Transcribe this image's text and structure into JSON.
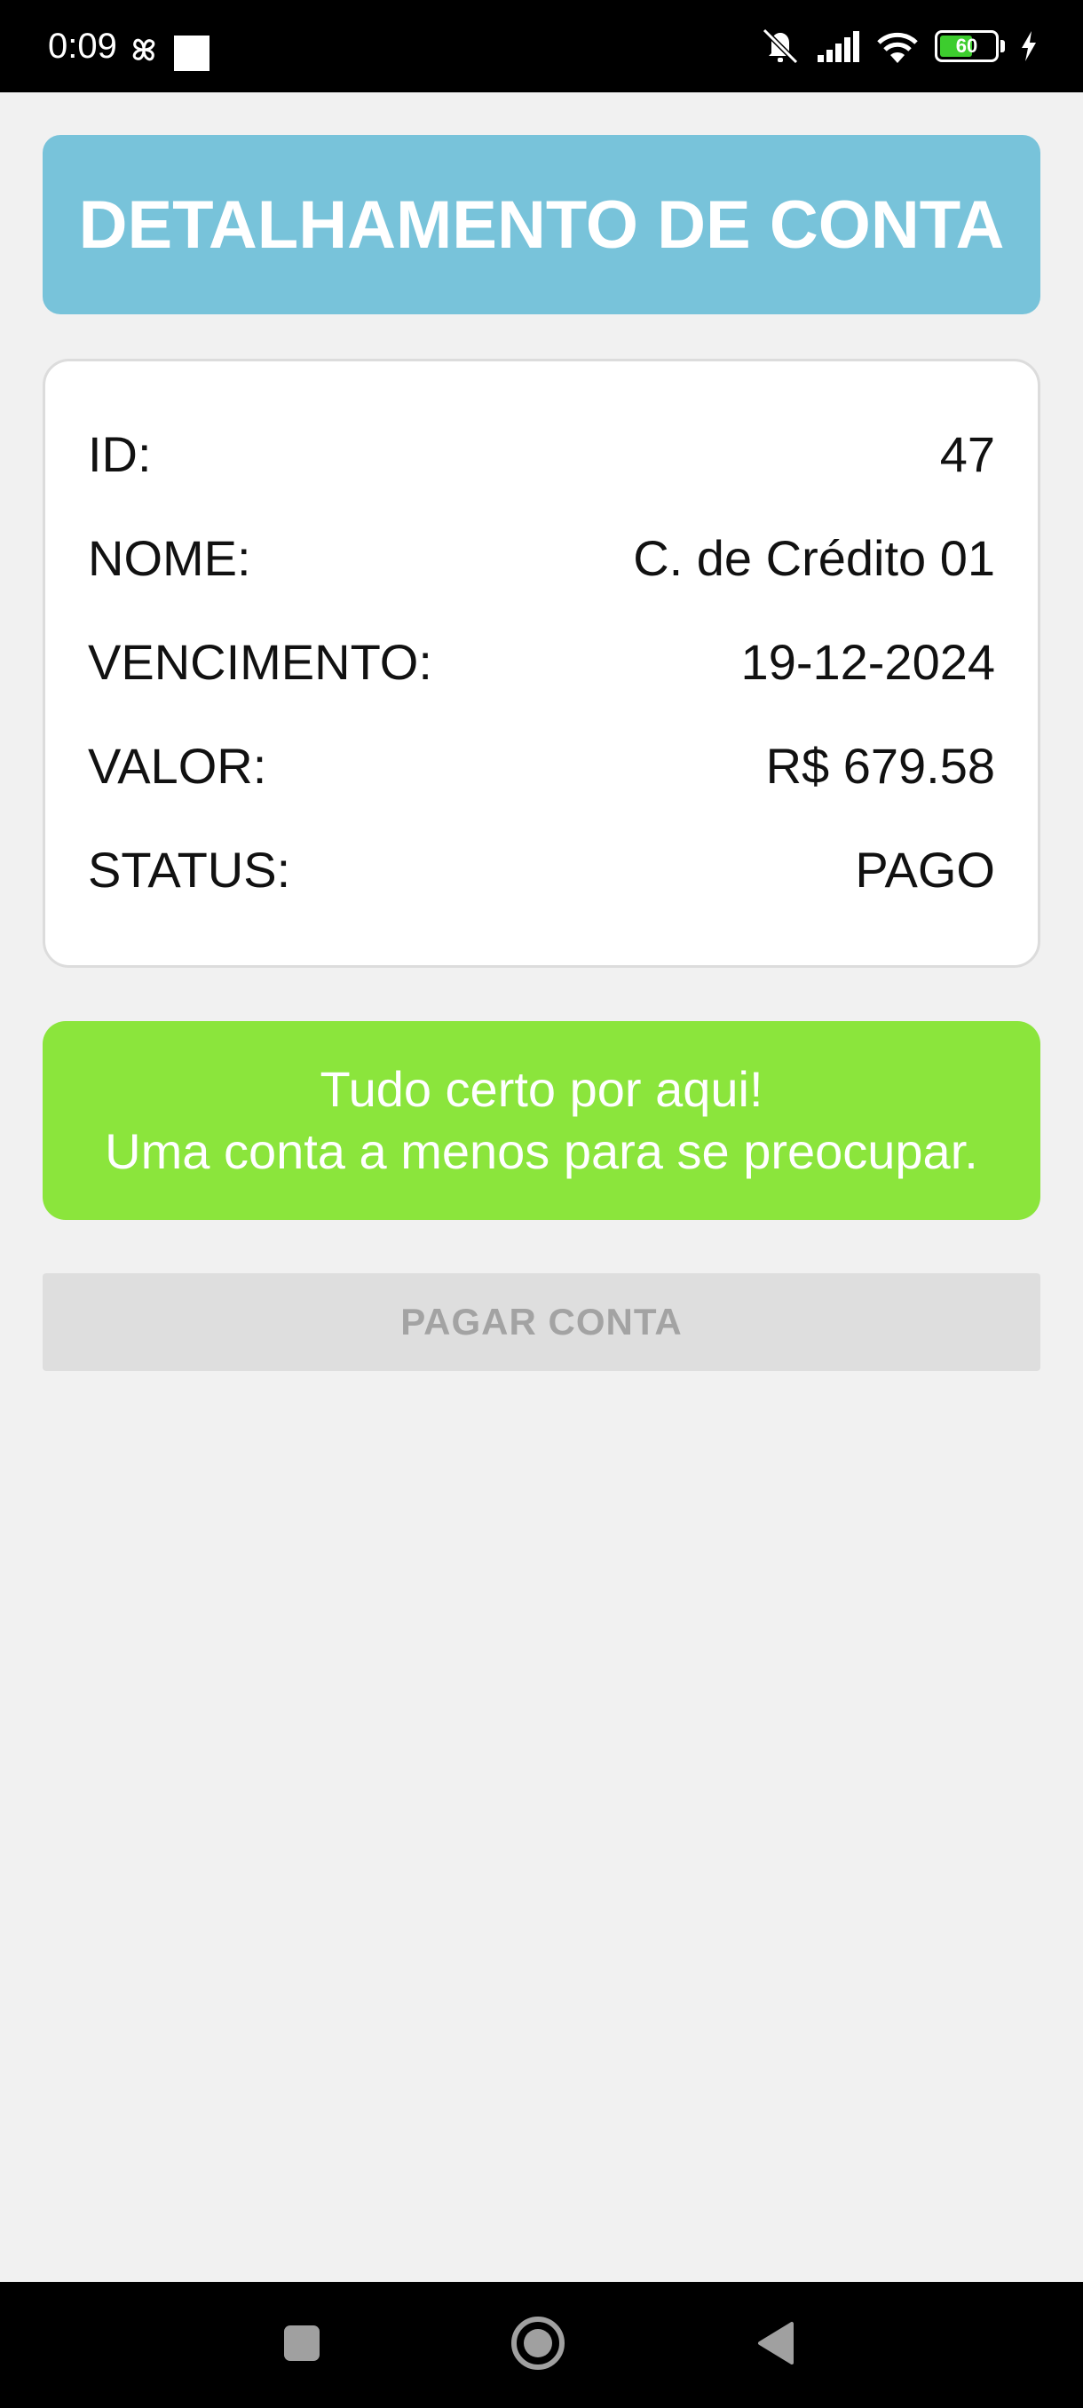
{
  "status_bar": {
    "time": "0:09",
    "battery_level": "60",
    "battery_fraction": 0.6,
    "icons": [
      "fan-icon",
      "square-icon",
      "silent-bell-icon",
      "signal-icon",
      "wifi-icon",
      "battery-icon",
      "charging-icon"
    ]
  },
  "header": {
    "title": "DETALHAMENTO DE CONTA"
  },
  "details": {
    "rows": [
      {
        "label": "ID:",
        "value": "47"
      },
      {
        "label": "NOME:",
        "value": "C. de Crédito 01"
      },
      {
        "label": "VENCIMENTO:",
        "value": "19-12-2024"
      },
      {
        "label": "VALOR:",
        "value": "R$ 679.58"
      },
      {
        "label": "STATUS:",
        "value": "PAGO"
      }
    ]
  },
  "success_message": {
    "line1": "Tudo certo por aqui!",
    "line2": "Uma conta a menos para se preocupar."
  },
  "pay_button": {
    "label": "PAGAR CONTA"
  },
  "nav_bar": {
    "icons": [
      "recents-square-icon",
      "home-circle-icon",
      "back-triangle-icon"
    ]
  },
  "colors": {
    "header_bg": "#78c3da",
    "success_bg": "#8be53c",
    "button_disabled_bg": "#dedede",
    "battery_fill": "#3dcd2e"
  }
}
